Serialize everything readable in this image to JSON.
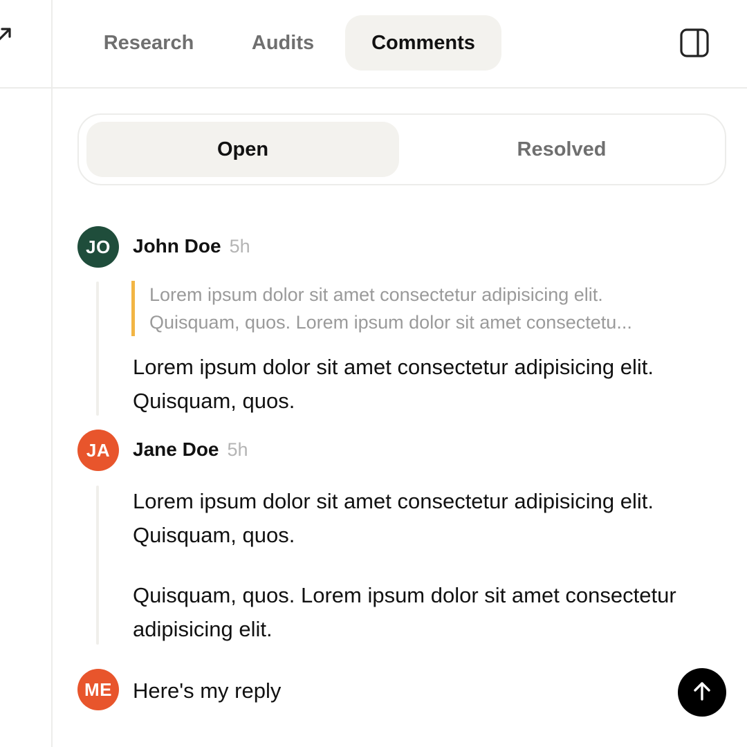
{
  "header": {
    "tabs": [
      {
        "label": "Research"
      },
      {
        "label": "Audits"
      },
      {
        "label": "Comments",
        "active": true
      }
    ],
    "panel_toggle_icon": "sidebar-panel-icon",
    "left_icon": "arrow-up-right-icon"
  },
  "filter": {
    "open_label": "Open",
    "resolved_label": "Resolved",
    "selected": "Open"
  },
  "comments": [
    {
      "initials": "JO",
      "author": "John Doe",
      "time": "5h",
      "avatar_color": "#1f4d3b",
      "quote_lines": [
        "Lorem ipsum dolor sit amet consectetur adipisicing elit.",
        "Quisquam, quos. Lorem ipsum dolor sit amet consectetu..."
      ],
      "paragraphs": [
        "Lorem ipsum dolor sit amet consectetur adipisicing elit. Quisquam, quos."
      ]
    },
    {
      "initials": "JA",
      "author": "Jane Doe",
      "time": "5h",
      "avatar_color": "#e8552c",
      "paragraphs": [
        "Lorem ipsum dolor sit amet consectetur adipisicing elit. Quisquam, quos.",
        "Quisquam, quos. Lorem ipsum dolor sit amet consectetur adipisicing elit."
      ]
    }
  ],
  "reply": {
    "initials": "ME",
    "avatar_color": "#e8552c",
    "value": "Here's my reply",
    "send_icon": "arrow-up-icon"
  },
  "colors": {
    "quote_accent": "#f2b544",
    "active_bg": "#f3f2ee",
    "send_button": "#000000"
  }
}
